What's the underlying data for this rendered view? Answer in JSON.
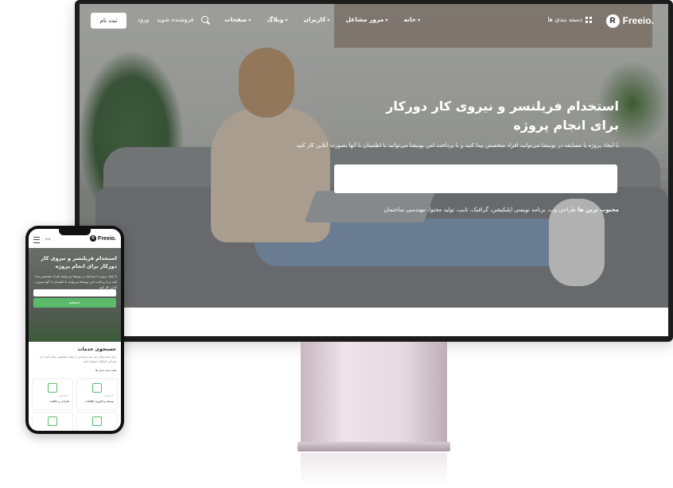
{
  "desktop": {
    "logo": {
      "mark": "R",
      "text": "Freeio."
    },
    "categories_label": "دسته بندی ها",
    "nav": [
      "خانه",
      "مرور مشاغل",
      "کاربران",
      "وبلاگ",
      "صفحات"
    ],
    "become_seller": "فروشنده شوید",
    "login": "ورود",
    "signup": "ثبت نام",
    "hero_title": "استخدام فریلنسر و نیروی کار دورکار برای انجام پروژه",
    "hero_subtitle": "با ایجاد پروژه یا مسابقه در پونیشا می‌توانید افراد متخصص پیدا کنید و با پرداخت امن پونیشا می‌توانید با اطمینان با آنها بصورت آنلاین کار کنید",
    "search_placeholder": "",
    "popular_label": "محبوب ترین ها",
    "popular_items": "طراحی وب، برنامه نویسی اپلیکیشن، گرافیک، تایپ، تولید محتوا، مهندسی ساختمان"
  },
  "mobile": {
    "logo": {
      "mark": "R",
      "text": "Freeio."
    },
    "login": "ورود",
    "hero_title": "استخدام فریلنسر و نیروی کار دورکار برای انجام پروژه",
    "hero_subtitle": "با ایجاد پروژه یا مسابقه در پونیشا می‌توانید افراد متخصص پیدا کنید و با پرداخت امن پونیشا می‌توانید با اطمینان با آنها بصورت آنلاین کار کنید",
    "search_button": "جستجو",
    "section_title": "جستجوی خدمات",
    "section_subtitle": "برای کسب‌وکار خود، هر سازمانی را تولید متخصص، تولید کنید یا از طراحی گرافیک استفاده کنید",
    "all_categories": "همه دسته بندی ها",
    "cards": [
      {
        "count": "۳ خدمات",
        "name": "توسعه و فناوری اطلاعات"
      },
      {
        "count": "۲ خدمات",
        "name": "طراحی و خلاقیت"
      }
    ]
  },
  "colors": {
    "accent": "#5bbb6b",
    "frame": "#1c1c1c",
    "stand": "#e6d9df"
  }
}
